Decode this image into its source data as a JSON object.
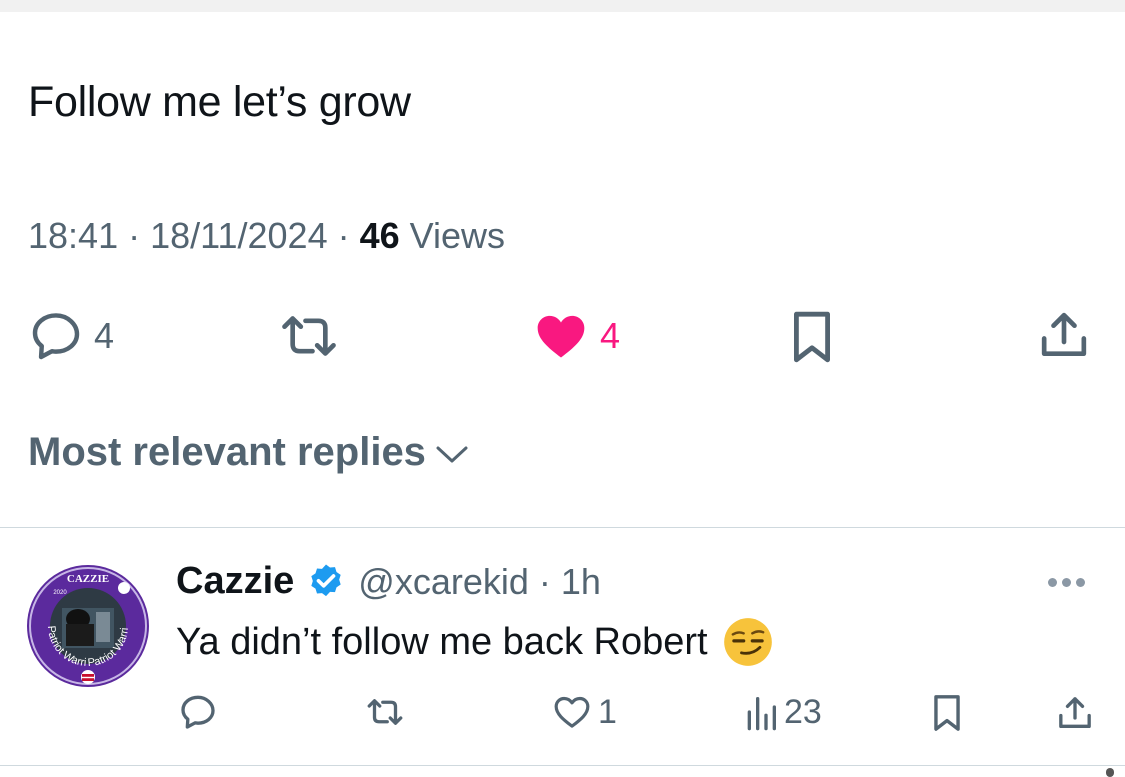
{
  "tweet": {
    "text": "Follow me let’s grow",
    "time": "18:41",
    "date": "18/11/2024",
    "separator": " · ",
    "views_count": "46",
    "views_label": " Views",
    "stats": {
      "replies": "4",
      "likes": "4"
    }
  },
  "replies_sort": {
    "label": "Most relevant replies"
  },
  "reply": {
    "name": "Cazzie",
    "handle_time": "@xcarekid · 1h",
    "text": "Ya didn’t follow me back Robert",
    "avatar_text": {
      "top": "CAZZIE",
      "year": "2020",
      "ring_left": "Patriot Warriors",
      "ring_right": "Patriot Warriors"
    },
    "stats": {
      "likes": "1",
      "views": "23"
    }
  },
  "icons": {
    "reply": "speech-bubble-icon",
    "retweet": "retweet-icon",
    "like": "heart-icon",
    "bookmark": "bookmark-icon",
    "share": "share-icon",
    "views": "bar-chart-icon",
    "verified": "verified-badge-icon",
    "more": "more-dots-icon",
    "emoji": "smirking-face-emoji"
  },
  "colors": {
    "text_primary": "#0f1419",
    "text_secondary": "#536471",
    "like_pink": "#f91880",
    "verified_blue": "#1d9bf0",
    "avatar_ring_purple": "#5b2a9d"
  }
}
